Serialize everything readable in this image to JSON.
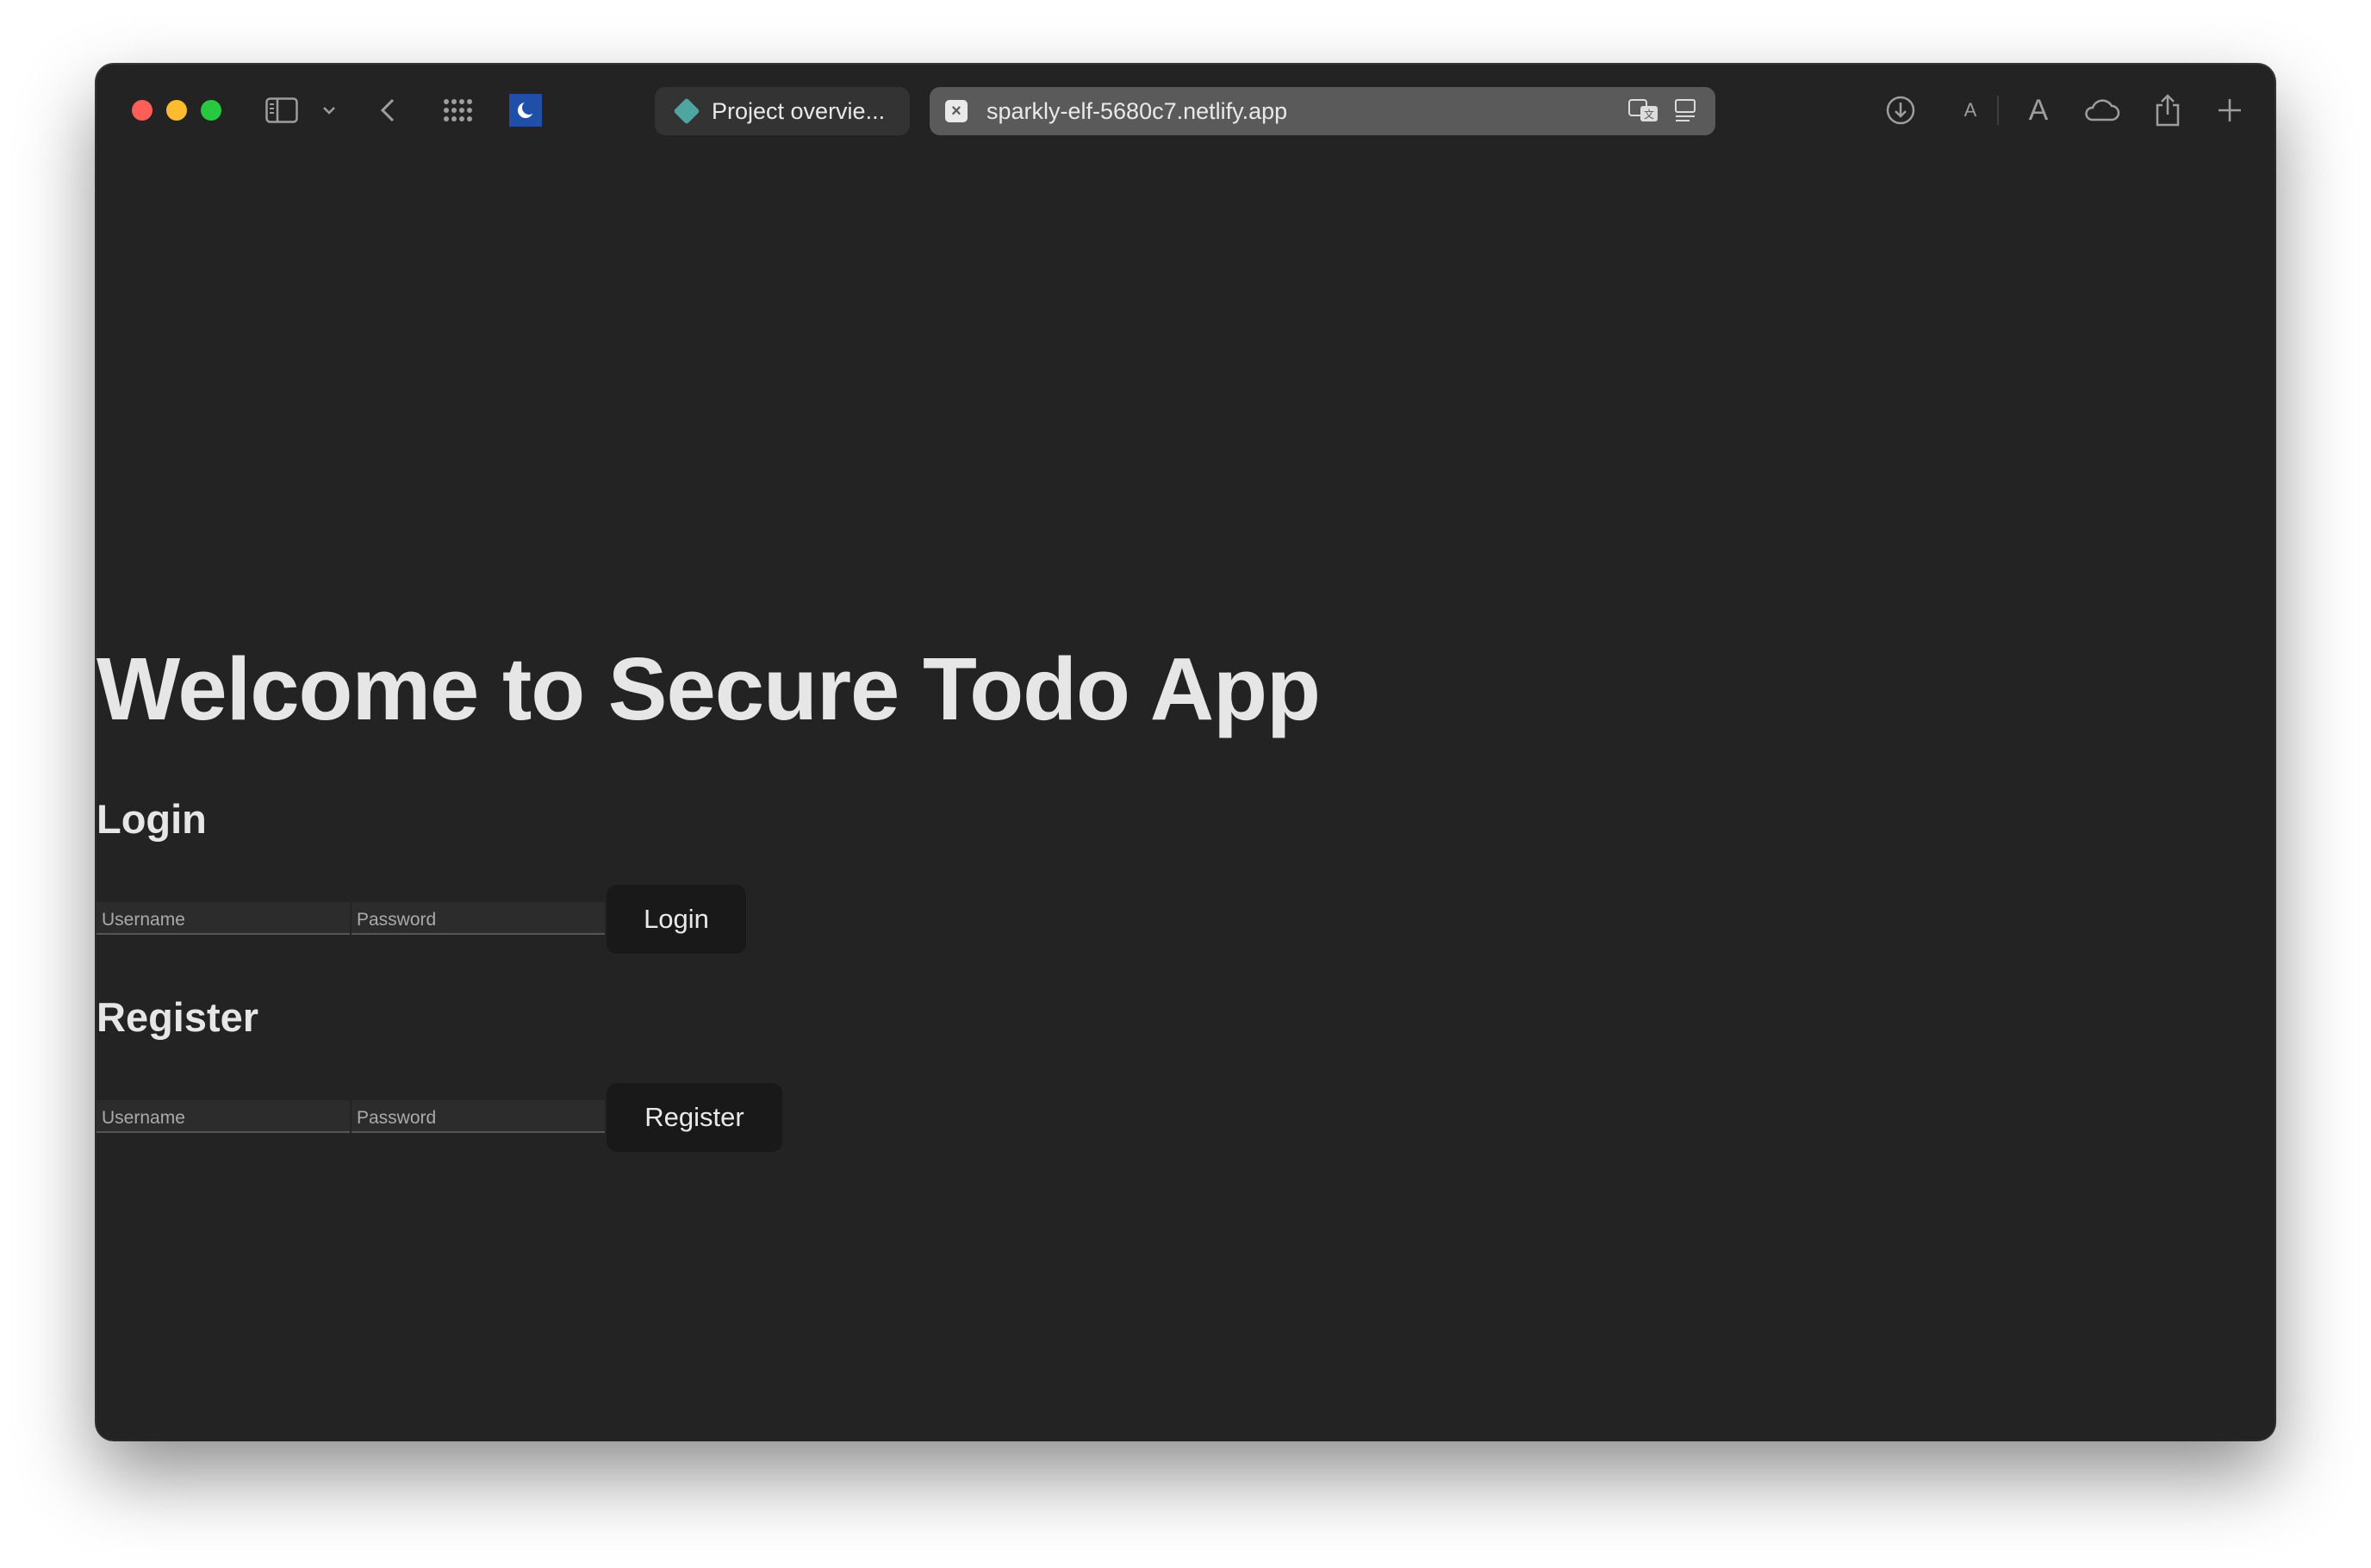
{
  "browser": {
    "tabs": [
      {
        "label": "Project overvie...",
        "icon": "diamond-favicon-icon",
        "active": false
      },
      {
        "label": "sparkly-elf-5680c7.netlify.app",
        "icon": "close-favicon-icon",
        "active": true
      }
    ],
    "colors": {
      "close": "#ff5f57",
      "minimize": "#febc2e",
      "maximize": "#28c840",
      "background": "#232323"
    },
    "font_small_label": "A",
    "font_large_label": "A"
  },
  "page": {
    "title": "Welcome to Secure Todo App",
    "login": {
      "heading": "Login",
      "username_placeholder": "Username",
      "password_placeholder": "Password",
      "button_label": "Login"
    },
    "register": {
      "heading": "Register",
      "username_placeholder": "Username",
      "password_placeholder": "Password",
      "button_label": "Register"
    }
  }
}
